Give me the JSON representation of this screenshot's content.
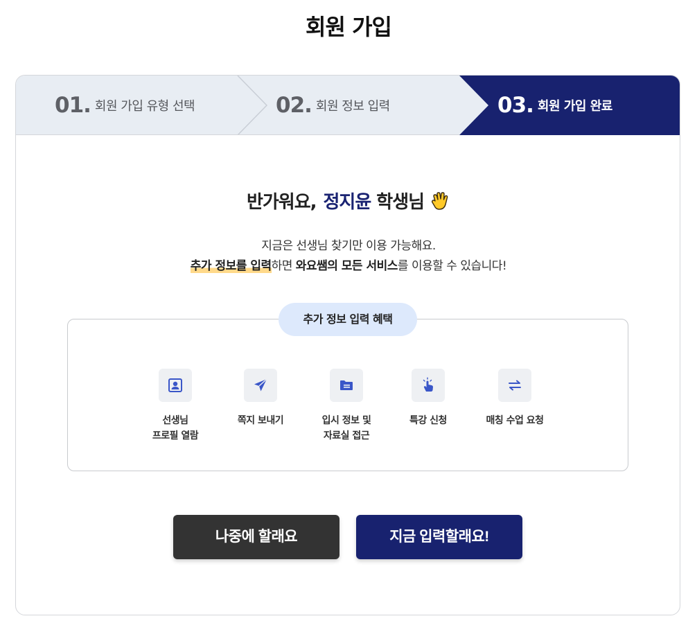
{
  "page": {
    "title": "회원 가입"
  },
  "steps": [
    {
      "num": "01.",
      "label": "회원 가입 유형 선택",
      "active": false
    },
    {
      "num": "02.",
      "label": "회원 정보 입력",
      "active": false
    },
    {
      "num": "03.",
      "label": "회원 가입 완료",
      "active": true
    }
  ],
  "welcome": {
    "prefix": "반가워요,",
    "name": "정지윤",
    "suffix": "학생님",
    "emoji_icon": "waving-hand-icon"
  },
  "description": {
    "line1": "지금은 선생님 찾기만 이용 가능해요.",
    "line2_highlight": "추가 정보를 입력",
    "line2_middle": "하면 ",
    "line2_bold": "와요쌤의 모든 서비스",
    "line2_end": "를 이용할 수 있습니다!"
  },
  "benefits": {
    "title": "추가 정보 입력 혜택",
    "items": [
      {
        "icon": "profile-card-icon",
        "line1": "선생님",
        "line2": "프로필 열람"
      },
      {
        "icon": "paper-plane-icon",
        "line1": "쪽지 보내기",
        "line2": ""
      },
      {
        "icon": "folder-icon",
        "line1": "입시 정보 및",
        "line2": "자료실 접근"
      },
      {
        "icon": "hand-pointer-icon",
        "line1": "특강 신청",
        "line2": ""
      },
      {
        "icon": "swap-arrows-icon",
        "line1": "매칭 수업 요청",
        "line2": ""
      }
    ]
  },
  "buttons": {
    "later": "나중에 할래요",
    "now": "지금 입력할래요!"
  },
  "colors": {
    "primary": "#18226f",
    "step_inactive_bg": "#e8edf3",
    "highlight": "#ffd98a",
    "icon_blue": "#3a56c8",
    "later_button": "#333333"
  }
}
